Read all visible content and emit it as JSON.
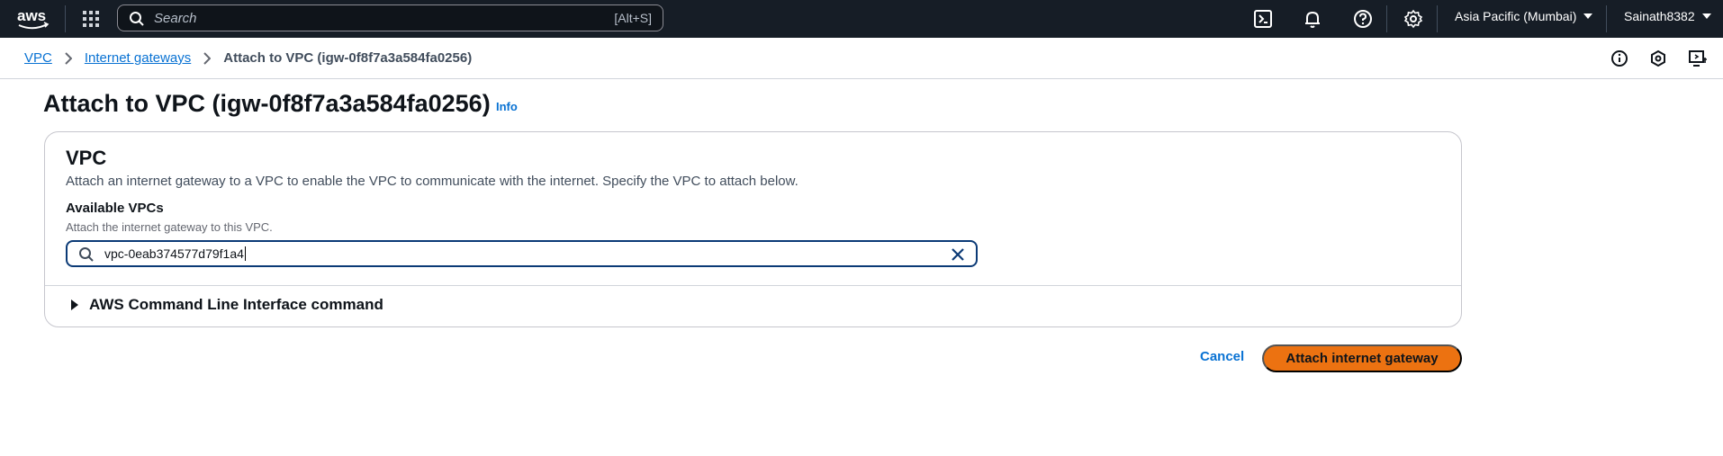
{
  "topnav": {
    "logo": "aws-logo",
    "search": {
      "placeholder": "Search",
      "shortcut": "[Alt+S]"
    },
    "icons": [
      "apps-grid-icon",
      "cloudshell-icon",
      "notifications-bell-icon",
      "help-icon",
      "settings-gear-icon"
    ],
    "region": "Asia Pacific (Mumbai)",
    "user": "Sainath8382"
  },
  "breadcrumb": {
    "items": [
      "VPC",
      "Internet gateways"
    ],
    "current": "Attach to VPC (igw-0f8f7a3a584fa0256)",
    "tools": [
      "info-icon",
      "feedback-icon",
      "display-preferences-icon"
    ]
  },
  "main": {
    "title": "Attach to VPC (igw-0f8f7a3a584fa0256)",
    "info": "Info",
    "card": {
      "heading": "VPC",
      "description": "Attach an internet gateway to a VPC to enable the VPC to communicate with the internet. Specify the VPC to attach below.",
      "field_label": "Available VPCs",
      "field_hint": "Attach the internet gateway to this VPC.",
      "field_value": "vpc-0eab374577d79f1a4",
      "cli_label": "AWS Command Line Interface command"
    },
    "actions": {
      "cancel": "Cancel",
      "submit": "Attach internet gateway"
    }
  },
  "colors": {
    "nav_bg": "#161d26",
    "link": "#0972d3",
    "primary_button": "#ec7211",
    "input_border": "#0b3a76"
  }
}
